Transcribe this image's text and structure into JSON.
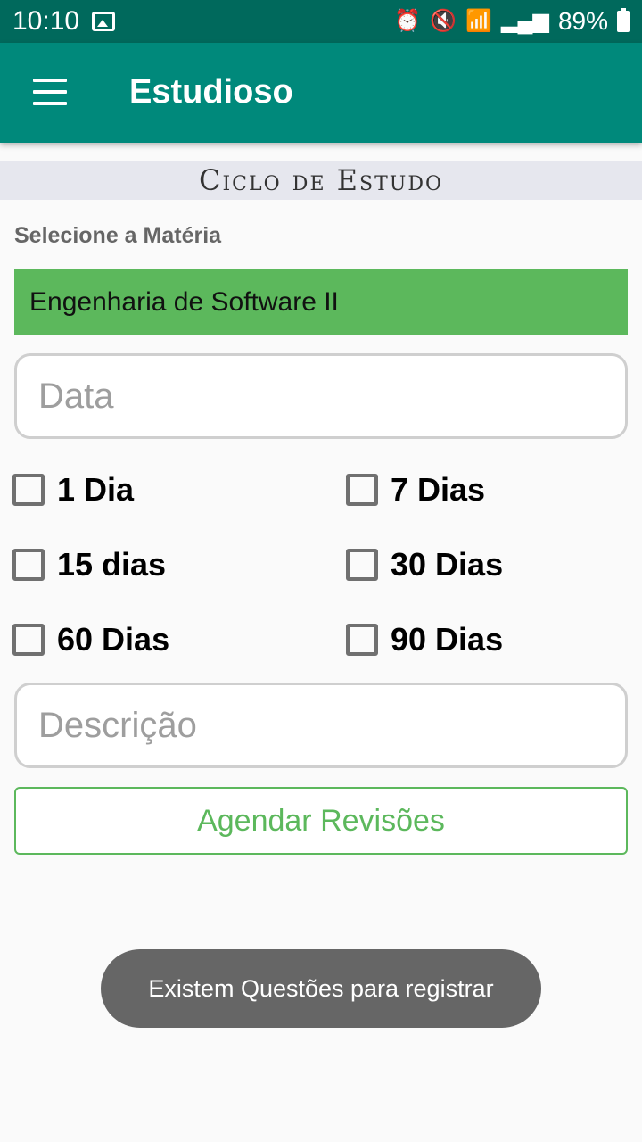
{
  "status_bar": {
    "time": "10:10",
    "battery": "89%",
    "icons": [
      "image-icon",
      "alarm-icon",
      "mute-icon",
      "wifi-icon",
      "signal-icon",
      "signal-icon",
      "battery-icon"
    ]
  },
  "app_bar": {
    "title": "Estudioso",
    "menu_icon": "hamburger-menu-icon"
  },
  "section": {
    "title": "Ciclo de Estudo"
  },
  "form": {
    "subject_label": "Selecione a Matéria",
    "subject_value": "Engenharia de Software II",
    "date_placeholder": "Data",
    "checkboxes": [
      {
        "label": "1 Dia",
        "checked": false
      },
      {
        "label": "7 Dias",
        "checked": false
      },
      {
        "label": "15 dias",
        "checked": false
      },
      {
        "label": "30 Dias",
        "checked": false
      },
      {
        "label": "60 Dias",
        "checked": false
      },
      {
        "label": "90 Dias",
        "checked": false
      }
    ],
    "description_placeholder": "Descrição",
    "schedule_button": "Agendar Revisões"
  },
  "toast": {
    "message": "Existem Questões para registrar"
  },
  "colors": {
    "status_bar": "#00695c",
    "app_bar": "#00897b",
    "accent_green": "#5cb85c",
    "section_bg": "#e6e7ee",
    "toast_bg": "#666666"
  }
}
